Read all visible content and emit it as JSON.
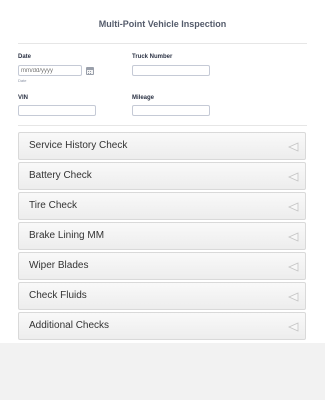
{
  "form": {
    "title": "Multi-Point Vehicle Inspection"
  },
  "fields": {
    "date": {
      "label": "Date",
      "placeholder": "mm/dd/yyyy",
      "sublabel": "Date"
    },
    "truck_number": {
      "label": "Truck Number",
      "value": ""
    },
    "vin": {
      "label": "VIN",
      "value": ""
    },
    "mileage": {
      "label": "Mileage",
      "value": ""
    }
  },
  "sections": [
    {
      "label": "Service History Check"
    },
    {
      "label": "Battery Check"
    },
    {
      "label": "Tire Check"
    },
    {
      "label": "Brake Lining MM"
    },
    {
      "label": "Wiper Blades"
    },
    {
      "label": "Check Fluids"
    },
    {
      "label": "Additional Checks"
    }
  ],
  "icons": {
    "calendar": "calendar-icon",
    "collapse": "collapse-arrow-icon"
  },
  "colors": {
    "background": "#f2f2f2",
    "section_fill": "#f0f0f0",
    "section_border": "#d9d9d9",
    "input_border": "#c5cad6"
  }
}
